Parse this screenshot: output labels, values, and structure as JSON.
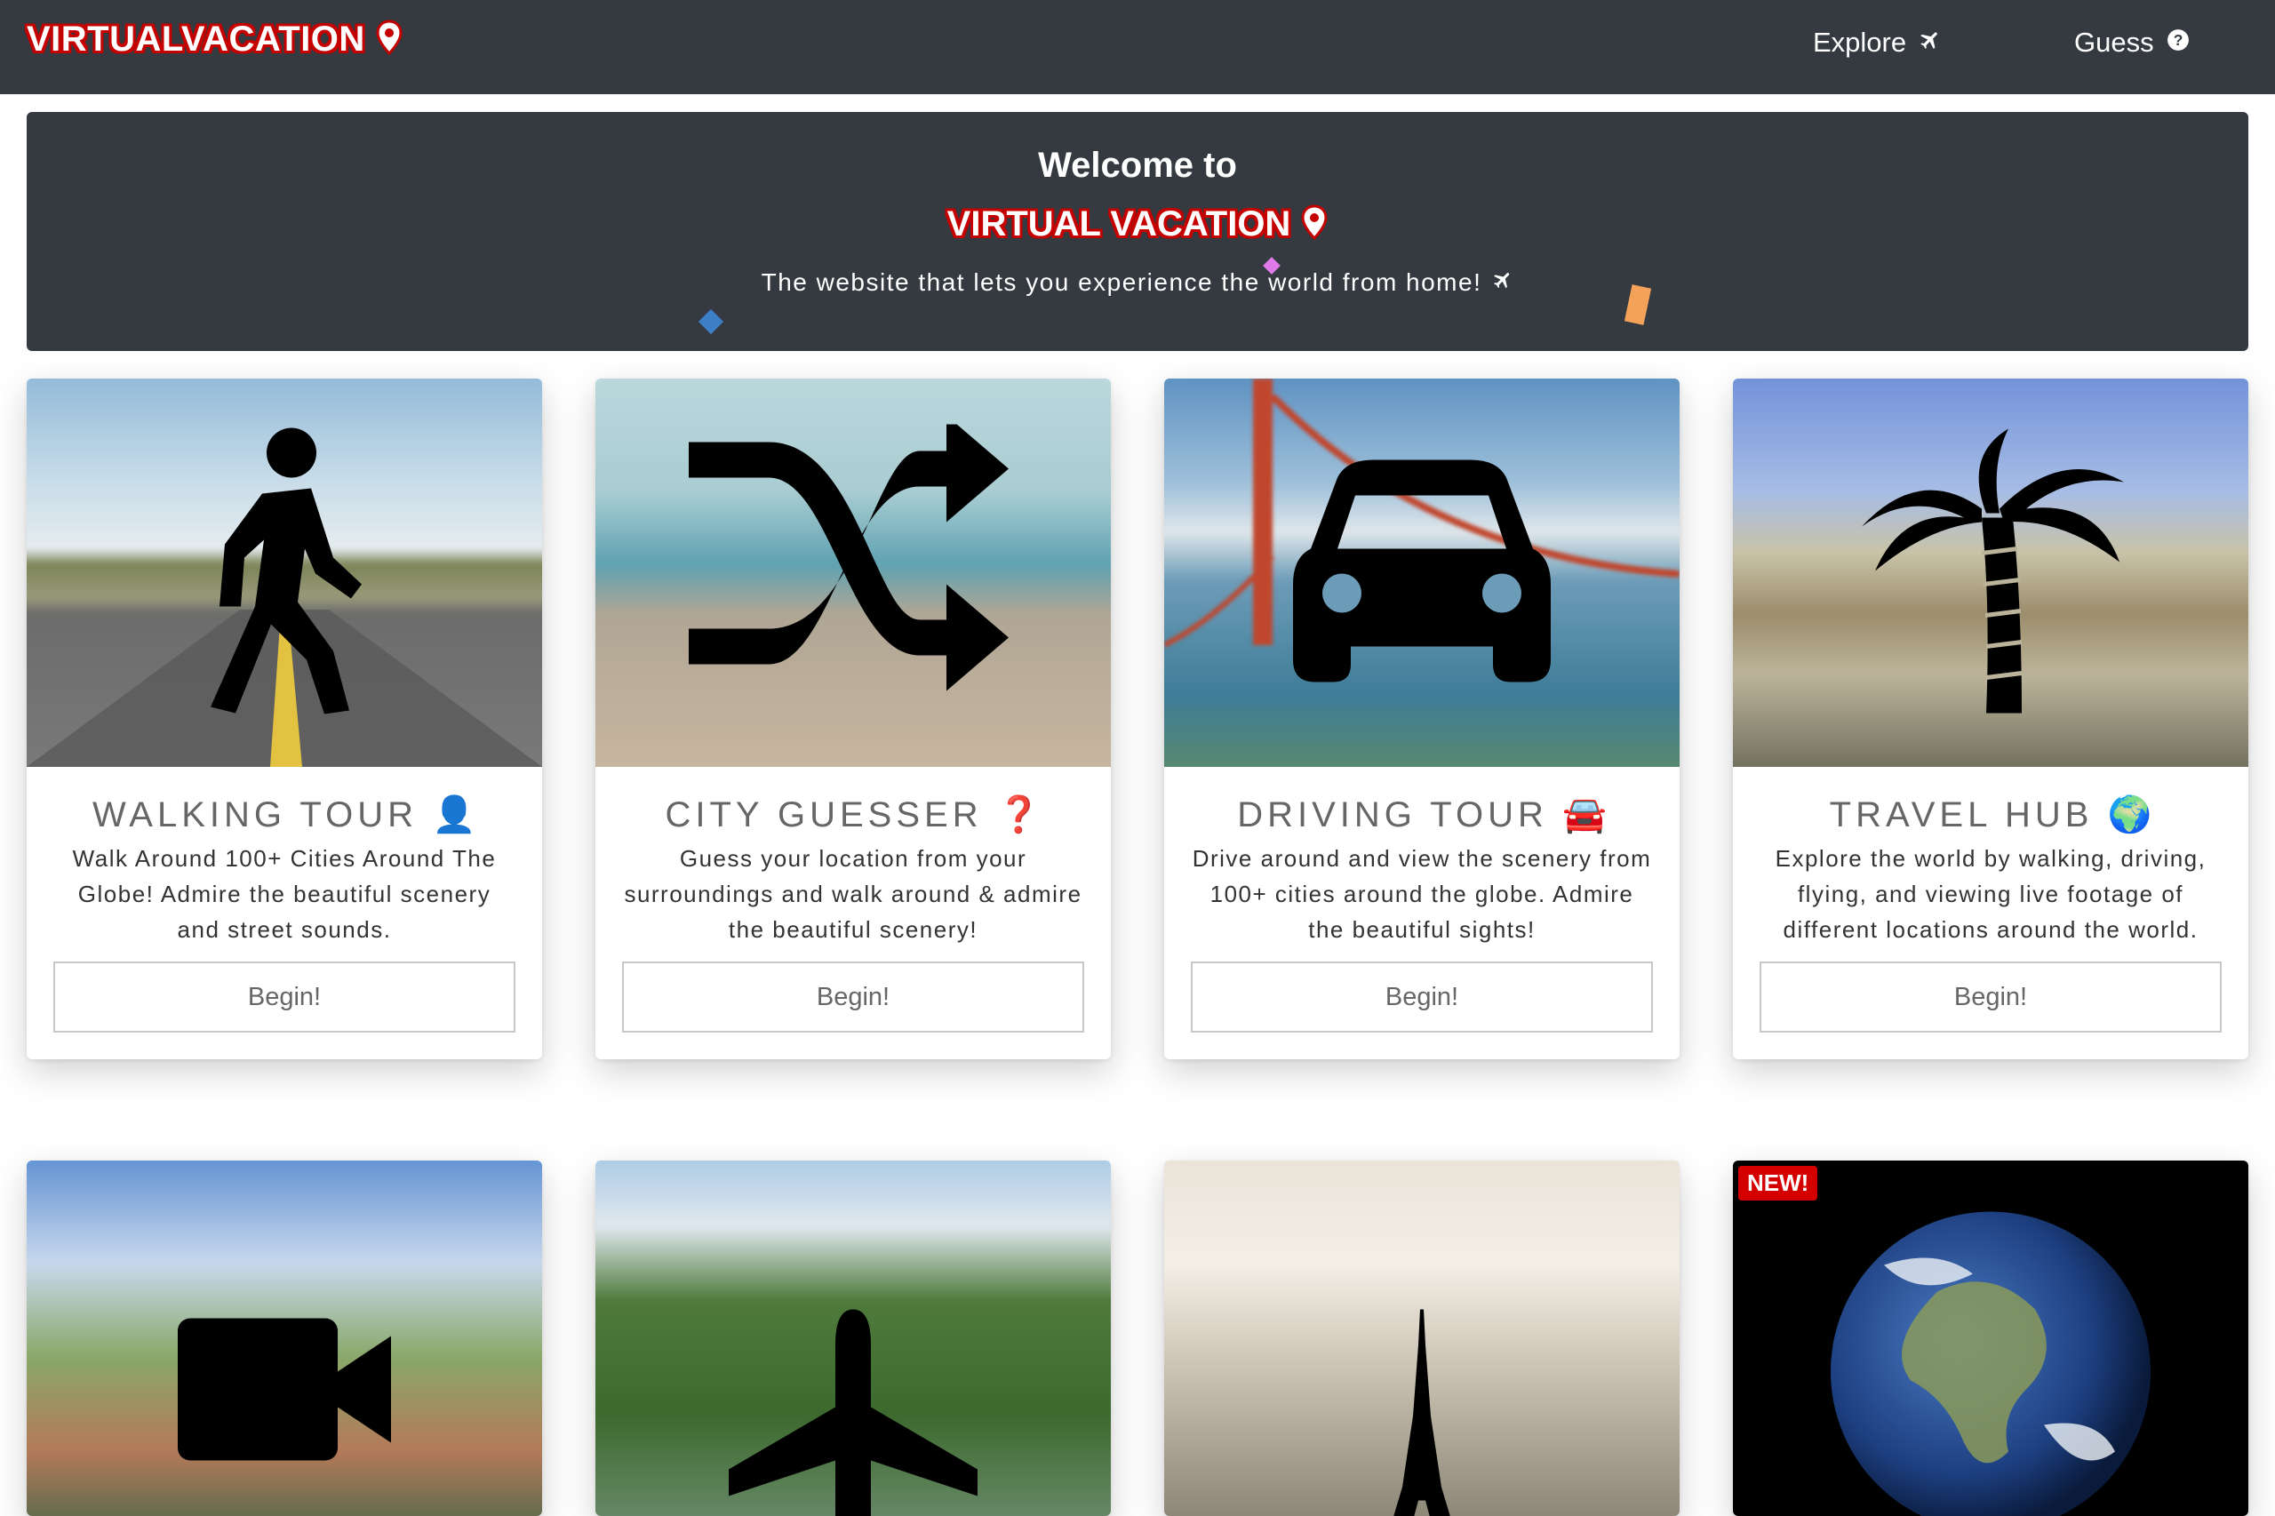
{
  "navbar": {
    "brand": "VIRTUALVACATION",
    "links": [
      {
        "label": "Explore",
        "icon": "plane-icon"
      },
      {
        "label": "Guess",
        "icon": "question-circle-icon"
      }
    ]
  },
  "hero": {
    "welcome": "Welcome to",
    "brand": "VIRTUAL VACATION",
    "tagline": "The website that lets you experience the world from home!"
  },
  "cards": [
    {
      "title": "WALKING TOUR",
      "emoji": "👤",
      "description": "Walk Around 100+ Cities Around The Globe! Admire the beautiful scenery and street sounds.",
      "button": "Begin!",
      "icon": "walking-person-icon"
    },
    {
      "title": "CITY GUESSER",
      "emoji": "❓",
      "description": "Guess your location from your surroundings and walk around & admire the beautiful scenery!",
      "button": "Begin!",
      "icon": "shuffle-icon"
    },
    {
      "title": "DRIVING TOUR",
      "emoji": "🚘",
      "description": "Drive around and view the scenery from 100+ cities around the globe. Admire the beautiful sights!",
      "button": "Begin!",
      "icon": "car-icon"
    },
    {
      "title": "TRAVEL HUB",
      "emoji": "🌍",
      "description": "Explore the world by walking, driving, flying, and viewing live footage of different locations around the world.",
      "button": "Begin!",
      "icon": "palm-tree-icon"
    }
  ],
  "row2": [
    {
      "icon": "video-camera-icon"
    },
    {
      "icon": "airplane-icon"
    },
    {
      "icon": "eiffel-tower-icon"
    },
    {
      "icon": "earth-globe-icon",
      "badge": "NEW!"
    }
  ],
  "colors": {
    "navbar": "#343a40",
    "brand_outline": "#c40000",
    "pin": "#c40000"
  }
}
